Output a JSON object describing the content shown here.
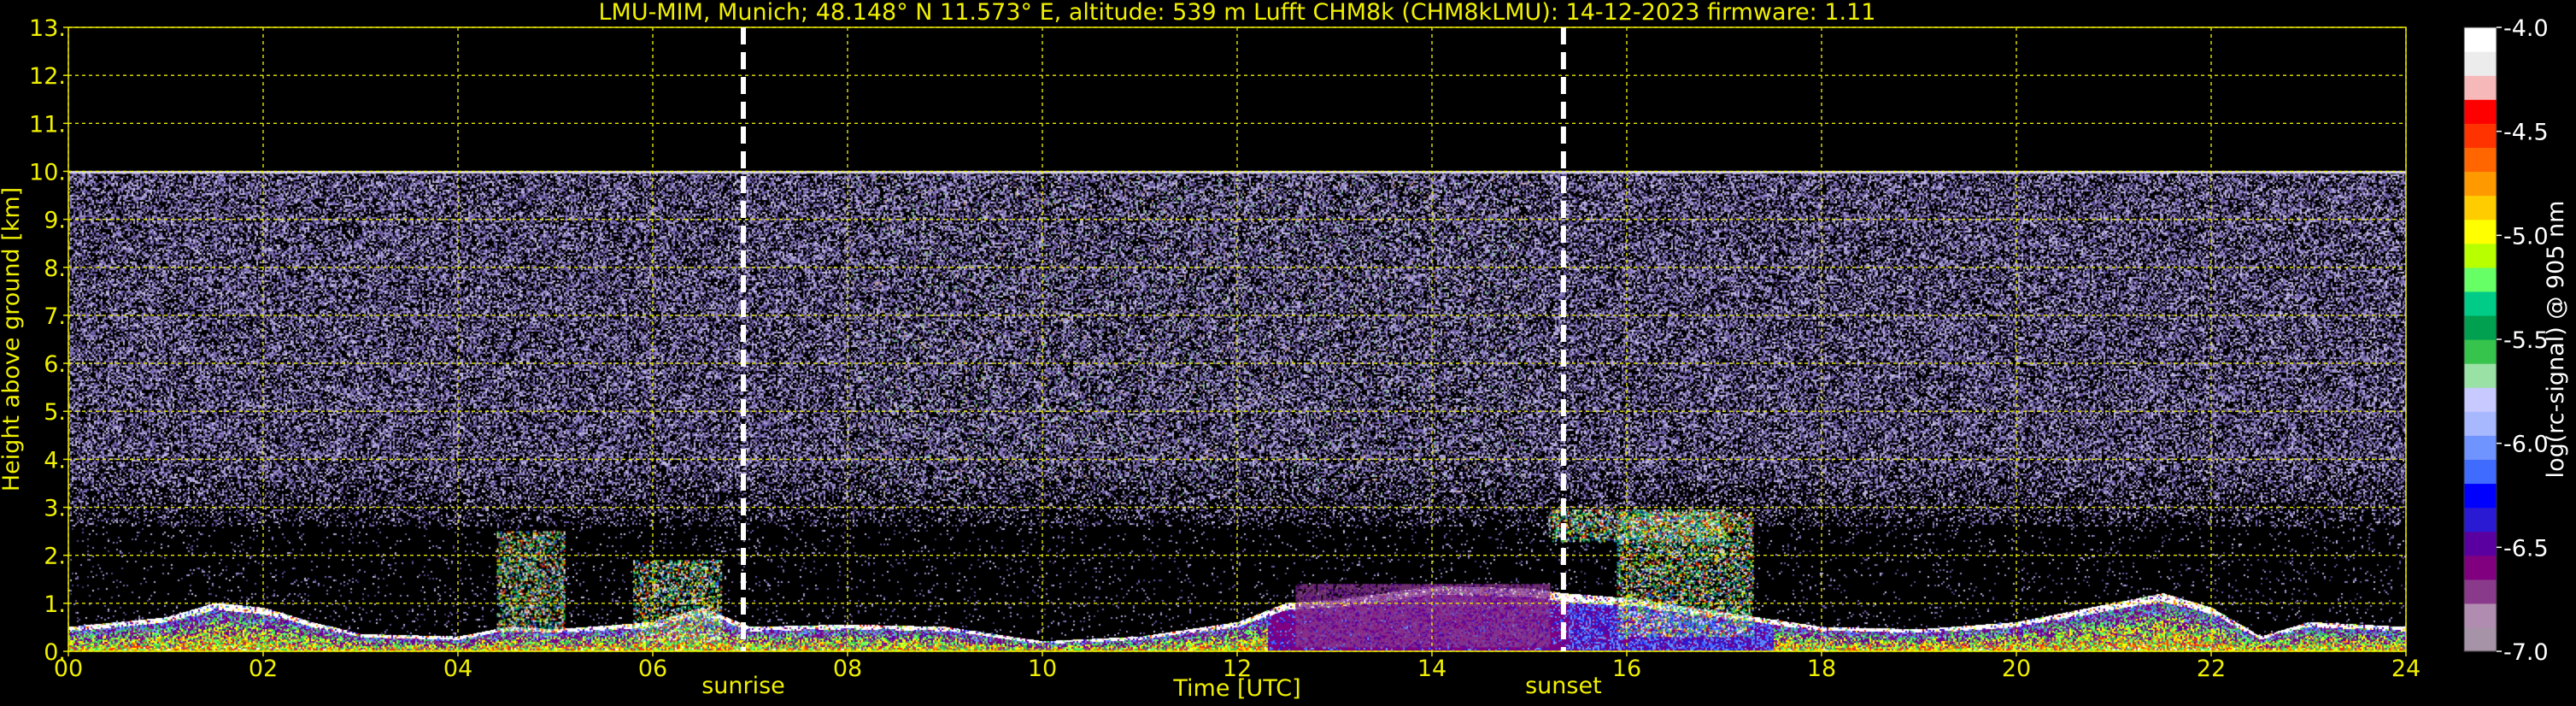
{
  "chart_data": {
    "type": "heatmap",
    "title": "LMU-MIM, Munich; 48.148° N 11.573° E, altitude: 539 m    Lufft CHM8k (CHM8kLMU): 14-12-2023    firmware: 1.11",
    "xlabel": "Time [UTC]",
    "ylabel": "Height above ground [km]",
    "xlim": [
      0,
      24
    ],
    "ylim": [
      0,
      13
    ],
    "x_ticks": [
      "00",
      "02",
      "04",
      "06",
      "08",
      "10",
      "12",
      "14",
      "16",
      "18",
      "20",
      "22",
      "24"
    ],
    "y_ticks": [
      "0.",
      "1.",
      "2.",
      "3.",
      "4.",
      "5.",
      "6.",
      "7.",
      "8.",
      "9.",
      "10.",
      "11.",
      "12.",
      "13."
    ],
    "grid": true,
    "markers": [
      {
        "label": "sunrise",
        "x": 6.93
      },
      {
        "label": "sunset",
        "x": 15.35
      }
    ],
    "signal_top_km": 10,
    "boundary_layer_top_km": [
      [
        0,
        0.5
      ],
      [
        1,
        0.7
      ],
      [
        1.5,
        1.0
      ],
      [
        2,
        0.9
      ],
      [
        2.5,
        0.6
      ],
      [
        3,
        0.35
      ],
      [
        4,
        0.3
      ],
      [
        4.5,
        0.5
      ],
      [
        5,
        0.45
      ],
      [
        6,
        0.6
      ],
      [
        6.5,
        0.9
      ],
      [
        7,
        0.5
      ],
      [
        8,
        0.55
      ],
      [
        9,
        0.5
      ],
      [
        10,
        0.2
      ],
      [
        11,
        0.3
      ],
      [
        11.5,
        0.45
      ],
      [
        12,
        0.6
      ],
      [
        12.5,
        1.0
      ],
      [
        13,
        1.05
      ],
      [
        14,
        1.35
      ],
      [
        15,
        1.3
      ],
      [
        15.35,
        1.2
      ],
      [
        16,
        1.1
      ],
      [
        17,
        0.8
      ],
      [
        18,
        0.5
      ],
      [
        19,
        0.45
      ],
      [
        20,
        0.6
      ],
      [
        21,
        1.0
      ],
      [
        21.5,
        1.2
      ],
      [
        22,
        0.9
      ],
      [
        22.5,
        0.3
      ],
      [
        23,
        0.6
      ],
      [
        24,
        0.5
      ]
    ],
    "cloud_features": [
      {
        "x0": 15.2,
        "x1": 17.0,
        "y0": 2.3,
        "y1": 2.95
      },
      {
        "x0": 15.9,
        "x1": 17.3,
        "y0": 0.3,
        "y1": 2.9
      },
      {
        "x0": 4.4,
        "x1": 5.1,
        "y0": 0.4,
        "y1": 2.5
      },
      {
        "x0": 5.8,
        "x1": 6.7,
        "y0": 0.2,
        "y1": 1.9
      },
      {
        "x0": 12.6,
        "x1": 15.2,
        "y0": 0.1,
        "y1": 1.4
      }
    ],
    "colorbar": {
      "label": "log(rc-signal) @ 905 nm",
      "min": -7.0,
      "max": -4.0,
      "ticks": [
        "-4.0",
        "-4.5",
        "-5.0",
        "-5.5",
        "-6.0",
        "-6.5",
        "-7.0"
      ],
      "colors": [
        "#a793a8",
        "#b08cb0",
        "#8a3a8a",
        "#800080",
        "#5a00a0",
        "#2a1ad4",
        "#0000ff",
        "#3f6cff",
        "#6f94ff",
        "#a7b8ff",
        "#c7c9ff",
        "#99e1a5",
        "#37c44d",
        "#00a050",
        "#00cc88",
        "#66ff66",
        "#b8ff00",
        "#ffff00",
        "#ffcc00",
        "#ff9900",
        "#ff6600",
        "#ff3300",
        "#ff0000",
        "#f6b8b8",
        "#ececec",
        "#ffffff"
      ]
    }
  }
}
